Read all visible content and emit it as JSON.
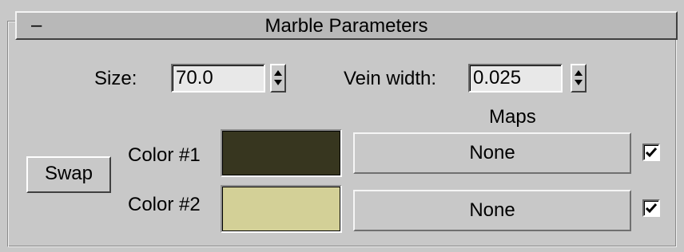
{
  "rollout": {
    "collapse_symbol": "–",
    "title": "Marble Parameters"
  },
  "params": {
    "size_label": "Size:",
    "size_value": "70.0",
    "vein_width_label": "Vein width:",
    "vein_width_value": "0.025"
  },
  "maps_header": "Maps",
  "swap_label": "Swap",
  "colors": [
    {
      "label": "Color #1",
      "swatch": "#37361f",
      "map_label": "None",
      "map_enabled": true
    },
    {
      "label": "Color #2",
      "swatch": "#d3d097",
      "map_label": "None",
      "map_enabled": true
    }
  ],
  "icons": {
    "spinner": "spinner-updown-icon",
    "checkmark": "checkmark-icon"
  }
}
